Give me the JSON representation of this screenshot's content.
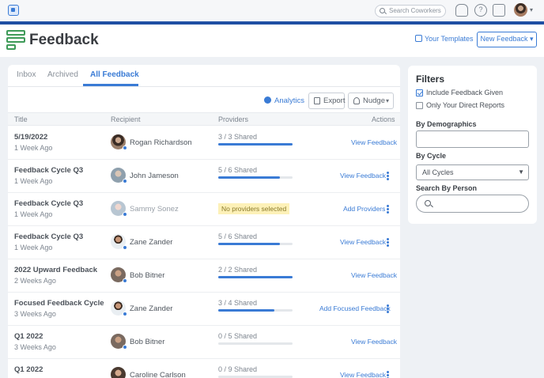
{
  "topbar": {
    "search_placeholder": "Search Coworkers"
  },
  "header": {
    "app_title": "Feedback",
    "your_templates_label": "Your Templates",
    "new_feedback_label": "New Feedback ▾"
  },
  "tabs": [
    {
      "label": "Inbox"
    },
    {
      "label": "Archived"
    },
    {
      "label": "All Feedback"
    }
  ],
  "actions": {
    "analytics_label": "Analytics",
    "export_label": "Export",
    "nudge_label": "Nudge"
  },
  "table": {
    "columns": [
      "Title",
      "Recipient",
      "Providers",
      "Actions"
    ],
    "rows": [
      {
        "title": "5/19/2022",
        "sub": "1 Week Ago",
        "recipient": "Rogan Richardson",
        "providers": "3 / 3 Shared",
        "progress": 1.0,
        "action": "View Feedback",
        "kebab": false
      },
      {
        "title": "Feedback Cycle Q3",
        "sub": "1 Week Ago",
        "recipient": "John Jameson",
        "providers": "5 / 6 Shared",
        "progress": 0.83,
        "action": "View Feedback",
        "kebab": true
      },
      {
        "title": "Feedback Cycle Q3",
        "sub": "1 Week Ago",
        "recipient": "Sammy Sonez",
        "providers": "No providers selected",
        "progress": null,
        "action": "Add Providers",
        "kebab": true
      },
      {
        "title": "Feedback Cycle Q3",
        "sub": "1 Week Ago",
        "recipient": "Zane Zander",
        "providers": "5 / 6 Shared",
        "progress": 0.83,
        "action": "View Feedback",
        "kebab": true
      },
      {
        "title": "2022 Upward Feedback",
        "sub": "2 Weeks Ago",
        "recipient": "Bob Bitner",
        "providers": "2 / 2 Shared",
        "progress": 1.0,
        "action": "View Feedback",
        "kebab": false
      },
      {
        "title": "Focused Feedback Cycle",
        "sub": "3 Weeks Ago",
        "recipient": "Zane Zander",
        "providers": "3 / 4 Shared",
        "progress": 0.75,
        "action": "Add Focused Feedback",
        "kebab": true
      },
      {
        "title": "Q1 2022",
        "sub": "3 Weeks Ago",
        "recipient": "Bob Bitner",
        "providers": "0 / 5 Shared",
        "progress": 0.0,
        "action": "View Feedback",
        "kebab": false
      },
      {
        "title": "Q1 2022",
        "sub": "",
        "recipient": "Caroline Carlson",
        "providers": "0 / 9 Shared",
        "progress": 0.0,
        "action": "View Feedback",
        "kebab": true
      }
    ]
  },
  "filters": {
    "title": "Filters",
    "include_feedback_given": "Include Feedback Given",
    "include_feedback_given_checked": true,
    "only_direct_reports": "Only Your Direct Reports",
    "only_direct_reports_checked": false,
    "by_demographics": "By Demographics",
    "by_cycle": "By Cycle",
    "cycle_value": "All Cycles",
    "search_by_person": "Search By Person"
  },
  "colors": {
    "accent": "#3a7bd5",
    "brand_green": "#3f9b59",
    "topbar_accent": "#1f4fa3",
    "warning_bg": "#fdf1b8"
  }
}
